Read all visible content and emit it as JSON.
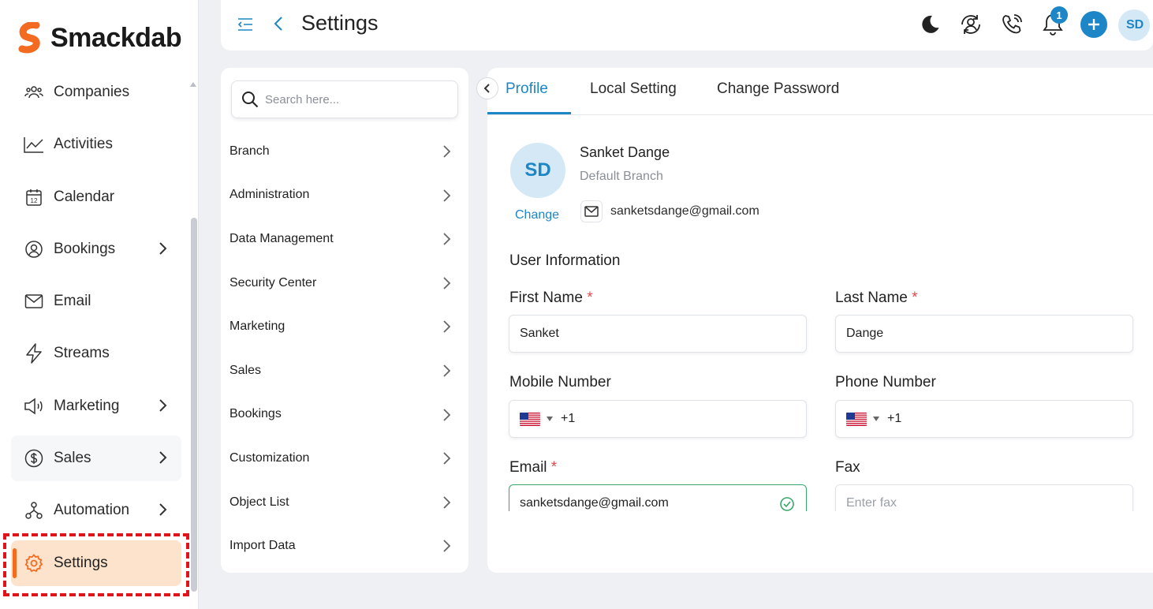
{
  "brand": {
    "name": "Smackdab",
    "accent": "#f26b21",
    "primary": "#1d86c6"
  },
  "header": {
    "title": "Settings",
    "notification_count": "1",
    "avatar_initials": "SD",
    "icons": [
      "menu-collapse-icon",
      "back-icon",
      "moon-icon",
      "user-sync-icon",
      "phone-icon",
      "bell-icon",
      "plus-icon"
    ]
  },
  "sidebar": {
    "items": [
      {
        "label": "Companies",
        "icon": "companies-icon",
        "has_children": false
      },
      {
        "label": "Activities",
        "icon": "activities-icon",
        "has_children": false
      },
      {
        "label": "Calendar",
        "icon": "calendar-icon",
        "has_children": false
      },
      {
        "label": "Bookings",
        "icon": "bookings-icon",
        "has_children": true
      },
      {
        "label": "Email",
        "icon": "email-icon",
        "has_children": false
      },
      {
        "label": "Streams",
        "icon": "streams-icon",
        "has_children": false
      },
      {
        "label": "Marketing",
        "icon": "megaphone-icon",
        "has_children": true
      },
      {
        "label": "Sales",
        "icon": "dollar-icon",
        "has_children": true
      },
      {
        "label": "Automation",
        "icon": "automation-icon",
        "has_children": true
      },
      {
        "label": "Settings",
        "icon": "gear-icon",
        "has_children": false,
        "active": true
      }
    ],
    "calendar_icon_day": "12"
  },
  "settings_menu": {
    "search_placeholder": "Search here...",
    "items": [
      "Branch",
      "Administration",
      "Data Management",
      "Security Center",
      "Marketing",
      "Sales",
      "Bookings",
      "Customization",
      "Object List",
      "Import Data"
    ]
  },
  "profile": {
    "tabs": [
      {
        "label": "Profile",
        "active": true
      },
      {
        "label": "Local Setting",
        "active": false
      },
      {
        "label": "Change Password",
        "active": false
      }
    ],
    "avatar_initials": "SD",
    "change_label": "Change",
    "name": "Sanket Dange",
    "branch": "Default Branch",
    "email": "sanketsdange@gmail.com",
    "section_title": "User Information",
    "required_mark": "*",
    "fields": {
      "first_name": {
        "label": "First Name",
        "value": "Sanket",
        "required": true
      },
      "last_name": {
        "label": "Last Name",
        "value": "Dange",
        "required": true
      },
      "mobile": {
        "label": "Mobile Number",
        "dial_code": "+1",
        "country": "us-flag-icon"
      },
      "phone": {
        "label": "Phone Number",
        "dial_code": "+1",
        "country": "us-flag-icon"
      },
      "email": {
        "label": "Email",
        "value": "sanketsdange@gmail.com",
        "required": true,
        "valid": true
      },
      "fax": {
        "label": "Fax",
        "value": "",
        "placeholder": "Enter fax"
      }
    }
  }
}
